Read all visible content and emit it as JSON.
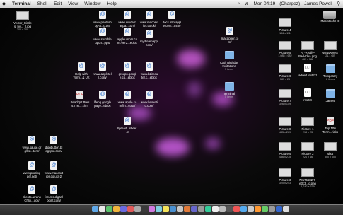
{
  "menubar": {
    "apple": "",
    "app": "Terminal",
    "items": [
      "Shell",
      "Edit",
      "View",
      "Window",
      "Help"
    ],
    "clock": "Mon 04:19",
    "input_lang": "(Chargez)",
    "user": "James Powell"
  },
  "hd": {
    "label": "Macintosh HD"
  },
  "icons": [
    {
      "t": "Vector_Circle s_by..._2.jpg",
      "s": "300 x 300",
      "k": "thumb"
    },
    {
      "t": "www.photosh op-a...g.de/",
      "k": "doc"
    },
    {
      "t": "www.insidem acpa...com/",
      "k": "doc"
    },
    {
      "t": "www.macosxt ips.co.uk/",
      "k": "doc"
    },
    {
      "t": "docs.info.appl e.com...5459",
      "k": "doc"
    },
    {
      "t": "macapper.co m/",
      "k": "doc"
    },
    {
      "t": "www.stumble upon...pps/",
      "k": "doc"
    },
    {
      "t": "appleumors.com /ver2...ebloc",
      "k": "doc"
    },
    {
      "t": "mydreamapp. com/",
      "k": "doc"
    },
    {
      "t": "Help with Term...& UK",
      "k": "doc"
    },
    {
      "t": "www.appletel l.com/",
      "k": "doc"
    },
    {
      "t": "groups.googl e.co...ebloc",
      "k": "doc"
    },
    {
      "t": "www.b2imou ter.c...ebloc",
      "k": "doc"
    },
    {
      "t": "Cath Birthday Invitations",
      "s": "7 items",
      "k": "folder"
    },
    {
      "t": "Peachpit.Pres s.The....chm",
      "k": "pdf"
    },
    {
      "t": "lifeng.google page...ebloc",
      "k": "doc"
    },
    {
      "t": "www.apple.co m/lin...cosx/",
      "k": "doc"
    },
    {
      "t": "www.basketi o.com/",
      "k": "doc"
    },
    {
      "t": "Terminal",
      "s": "5 items",
      "k": "folder"
    },
    {
      "t": "Spread...sheet...n",
      "k": "doc"
    },
    {
      "t": "www.sause.or g/list...tenr/",
      "k": "doc"
    },
    {
      "t": "diggbutton.bl ogspot.com/",
      "k": "doc"
    },
    {
      "t": "www.problog ger.net/",
      "k": "doc"
    },
    {
      "t": "www.macosxt ips.co.uk/-2",
      "k": "doc"
    },
    {
      "t": "clients.arrans Chloi...uck/",
      "k": "doc"
    },
    {
      "t": "forums.digital point.com/",
      "k": "doc"
    },
    {
      "t": "Picture 4",
      "s": "196 x 111",
      "k": "thumb"
    },
    {
      "t": "Picture 5",
      "s": "1,085 x 682",
      "k": "thumb"
    },
    {
      "t": "A_-Really- Bad-Idea.png",
      "s": "461 x 388",
      "k": "thumb"
    },
    {
      "t": "WINDOWS",
      "s": "21.1 GB",
      "k": "thumb"
    },
    {
      "t": "Picture 6",
      "s": "183 x 25",
      "k": "thumb"
    },
    {
      "t": "advert text.txt",
      "k": "txt"
    },
    {
      "t": "Temporary",
      "s": "6 items",
      "k": "folder"
    },
    {
      "t": "Picture 7",
      "s": "326 x 159",
      "k": "thumb"
    },
    {
      "t": "rss.txt",
      "k": "txt"
    },
    {
      "t": "James",
      "k": "folder"
    },
    {
      "t": "Picture 8",
      "s": "485 x 269",
      "k": "thumb"
    },
    {
      "t": "Picture 1",
      "s": "213 x 23",
      "k": "thumb"
    },
    {
      "t": "Top 100 Term...ricks",
      "k": "pdf"
    },
    {
      "t": "Picture 9",
      "s": "486 x 275",
      "k": "thumb"
    },
    {
      "t": "Picture 2",
      "s": "221 x 46",
      "k": "thumb"
    },
    {
      "t": "shot",
      "s": "800 x 600",
      "k": "thumb"
    },
    {
      "t": "Picture 3",
      "s": "320 x 243",
      "k": "thumb"
    },
    {
      "t": "78176682 7-e3c3...o.png",
      "s": "1,242 x 679",
      "k": "thumb"
    }
  ],
  "dock": {
    "label": "Dock"
  }
}
